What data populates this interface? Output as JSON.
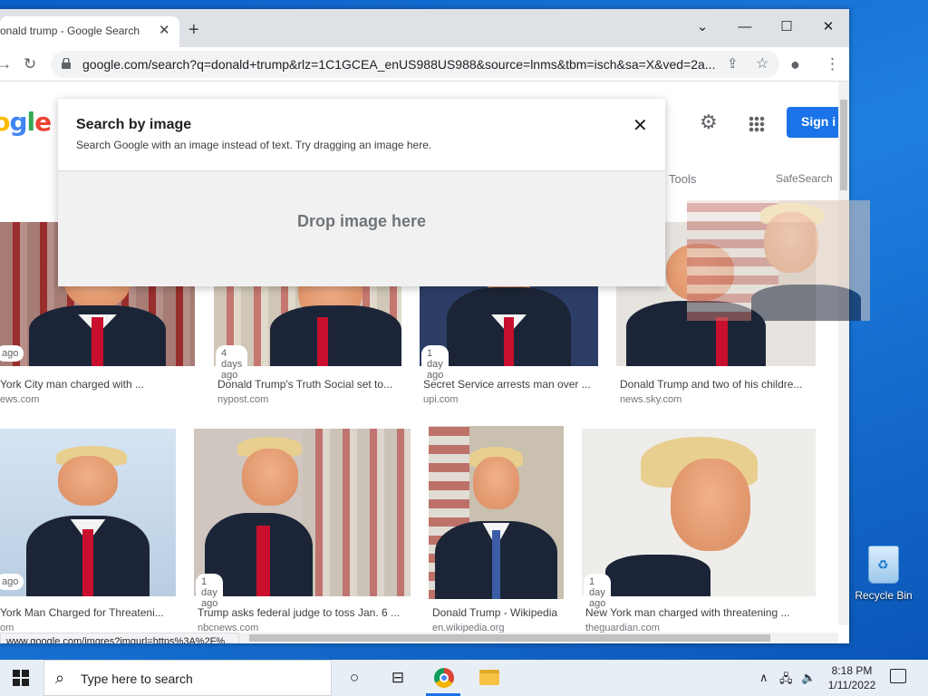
{
  "browser": {
    "tab_title": "onald trump - Google Search",
    "tab_close": "✕",
    "new_tab": "+",
    "window_controls": {
      "dropdown": "⌄",
      "minimize": "—",
      "maximize": "☐",
      "close": "✕"
    },
    "url": "google.com/search?q=donald+trump&rlz=1C1GCEA_enUS988US988&source=lnms&tbm=isch&sa=X&ved=2a..."
  },
  "google": {
    "logo_letters": [
      "o",
      "o",
      "g",
      "l",
      "e"
    ],
    "sign_in": "Sign i",
    "tools": "Tools",
    "safesearch": "SafeSearch"
  },
  "dialog": {
    "title": "Search by image",
    "subtitle": "Search Google with an image instead of text. Try dragging an image here.",
    "close": "✕",
    "drop_text": "Drop image here"
  },
  "results_row1": [
    {
      "badge": "ago",
      "caption": "York City man charged with ...",
      "source": "ews.com"
    },
    {
      "badge": "4 days ago",
      "caption": "Donald Trump's Truth Social set to...",
      "source": "nypost.com"
    },
    {
      "badge": "1 day ago",
      "caption": "Secret Service arrests man over ...",
      "source": "upi.com"
    },
    {
      "badge": "",
      "caption": "Donald Trump and two of his childre...",
      "source": "news.sky.com"
    }
  ],
  "results_row2": [
    {
      "badge": "ago",
      "caption": "York Man Charged for Threateni...",
      "source": "om"
    },
    {
      "badge": "1 day ago",
      "caption": "Trump asks federal judge to toss Jan. 6 ...",
      "source": "nbcnews.com"
    },
    {
      "badge": "",
      "caption": "Donald Trump - Wikipedia",
      "source": "en.wikipedia.org"
    },
    {
      "badge": "1 day ago",
      "caption": "New York man charged with threatening ...",
      "source": "theguardian.com"
    }
  ],
  "status_url": "www.google.com/imgres?imgurl=https%3A%2F%...",
  "desktop": {
    "recycle_bin": "Recycle Bin"
  },
  "taskbar": {
    "search_placeholder": "Type here to search",
    "time": "8:18 PM",
    "date": "1/11/2022"
  }
}
